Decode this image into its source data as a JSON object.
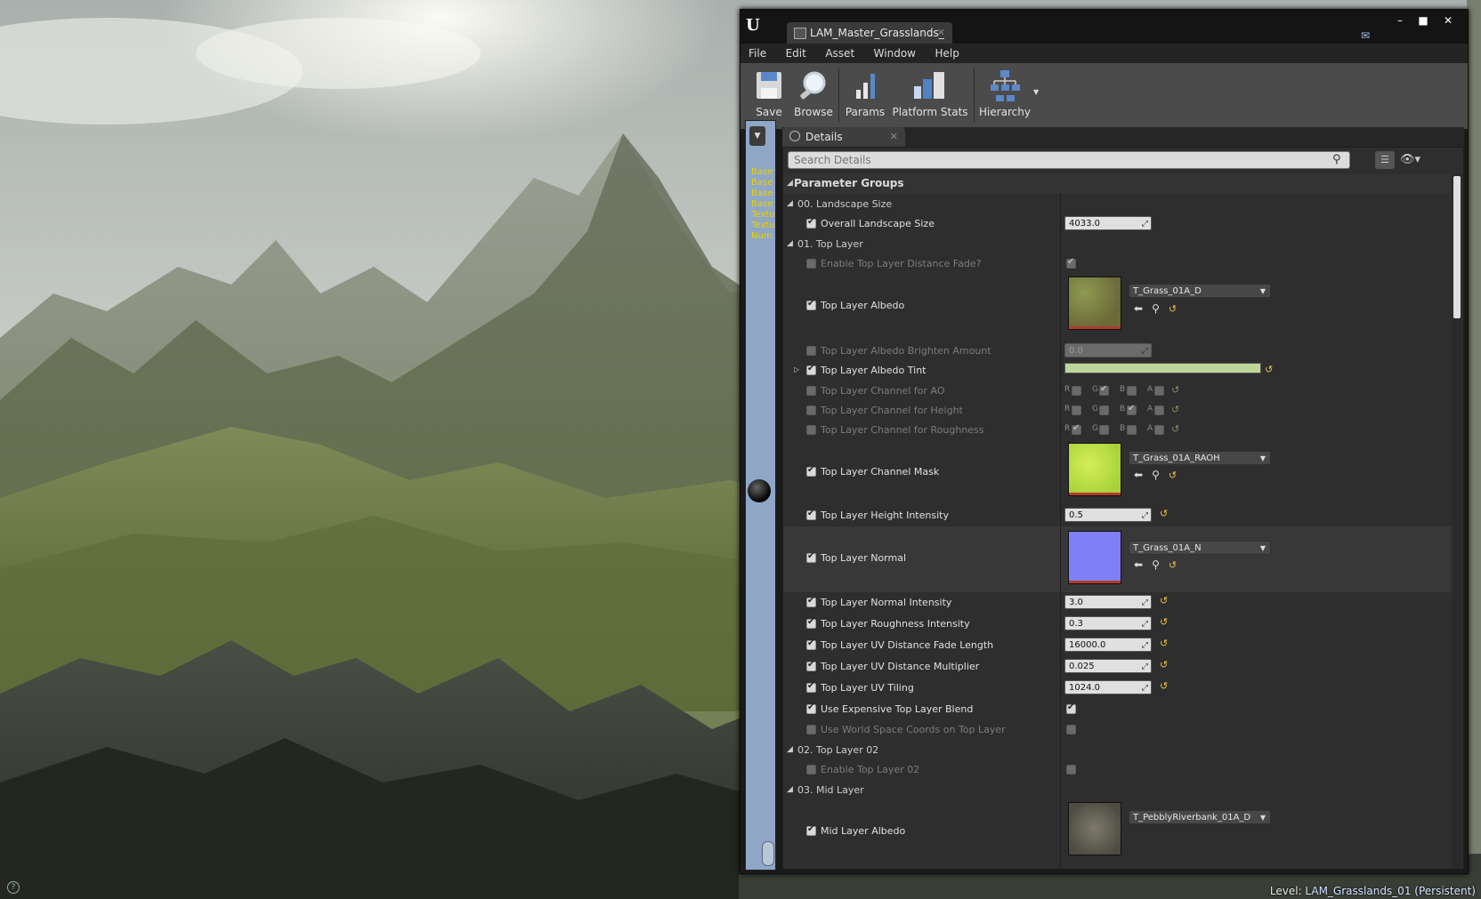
{
  "editor": {
    "asset_tab": "LAM_Master_Grasslands_",
    "window_buttons": [
      "–",
      "■",
      "✕"
    ]
  },
  "menu": [
    "File",
    "Edit",
    "Asset",
    "Window",
    "Help"
  ],
  "toolbar": {
    "save": "Save",
    "browse": "Browse",
    "params": "Params",
    "platform_stats": "Platform Stats",
    "hierarchy": "Hierarchy"
  },
  "side_strip": {
    "lines": [
      "Base",
      "Base",
      "Base",
      "Base",
      "Textu",
      "Textu",
      "Num"
    ]
  },
  "details": {
    "tab_label": "Details",
    "search_placeholder": "Search Details",
    "category": "Parameter Groups",
    "groups": {
      "g00": "00. Landscape Size",
      "g01": "01. Top Layer",
      "g02": "02. Top Layer 02",
      "g03": "03. Mid Layer"
    },
    "params": {
      "overall_size": {
        "label": "Overall Landscape Size",
        "value": "4033.0"
      },
      "enable_fade": {
        "label": "Enable Top Layer Distance Fade?"
      },
      "albedo": {
        "label": "Top Layer Albedo",
        "asset": "T_Grass_01A_D"
      },
      "albedo_brighten": {
        "label": "Top Layer Albedo Brighten Amount",
        "value": "0.0"
      },
      "albedo_tint": {
        "label": "Top Layer Albedo Tint",
        "color": "#bfd69a"
      },
      "channel_ao": {
        "label": "Top Layer Channel for AO"
      },
      "channel_height": {
        "label": "Top Layer Channel for Height"
      },
      "channel_rough": {
        "label": "Top Layer Channel for Roughness"
      },
      "channel_mask": {
        "label": "Top Layer Channel Mask",
        "asset": "T_Grass_01A_RAOH"
      },
      "height_intensity": {
        "label": "Top Layer Height Intensity",
        "value": "0.5"
      },
      "normal": {
        "label": "Top Layer Normal",
        "asset": "T_Grass_01A_N"
      },
      "normal_intensity": {
        "label": "Top Layer Normal Intensity",
        "value": "3.0"
      },
      "rough_intensity": {
        "label": "Top Layer Roughness Intensity",
        "value": "0.3"
      },
      "uv_fade_len": {
        "label": "Top Layer UV Distance Fade Length",
        "value": "16000.0"
      },
      "uv_dist_mult": {
        "label": "Top Layer UV Distance Multiplier",
        "value": "0.025"
      },
      "uv_tiling": {
        "label": "Top Layer UV Tiling",
        "value": "1024.0"
      },
      "expensive_blend": {
        "label": "Use Expensive Top Layer Blend"
      },
      "world_coords": {
        "label": "Use World Space Coords on Top Layer"
      },
      "enable_top02": {
        "label": "Enable Top Layer 02"
      },
      "mid_albedo": {
        "label": "Mid Layer Albedo",
        "asset": "T_PebblyRiverbank_01A_D"
      }
    },
    "channel_letters": [
      "R",
      "G",
      "B",
      "A"
    ]
  },
  "status": {
    "level_prefix": "Level:",
    "level_name": "LAM_Grasslands_01 (Persistent)"
  }
}
